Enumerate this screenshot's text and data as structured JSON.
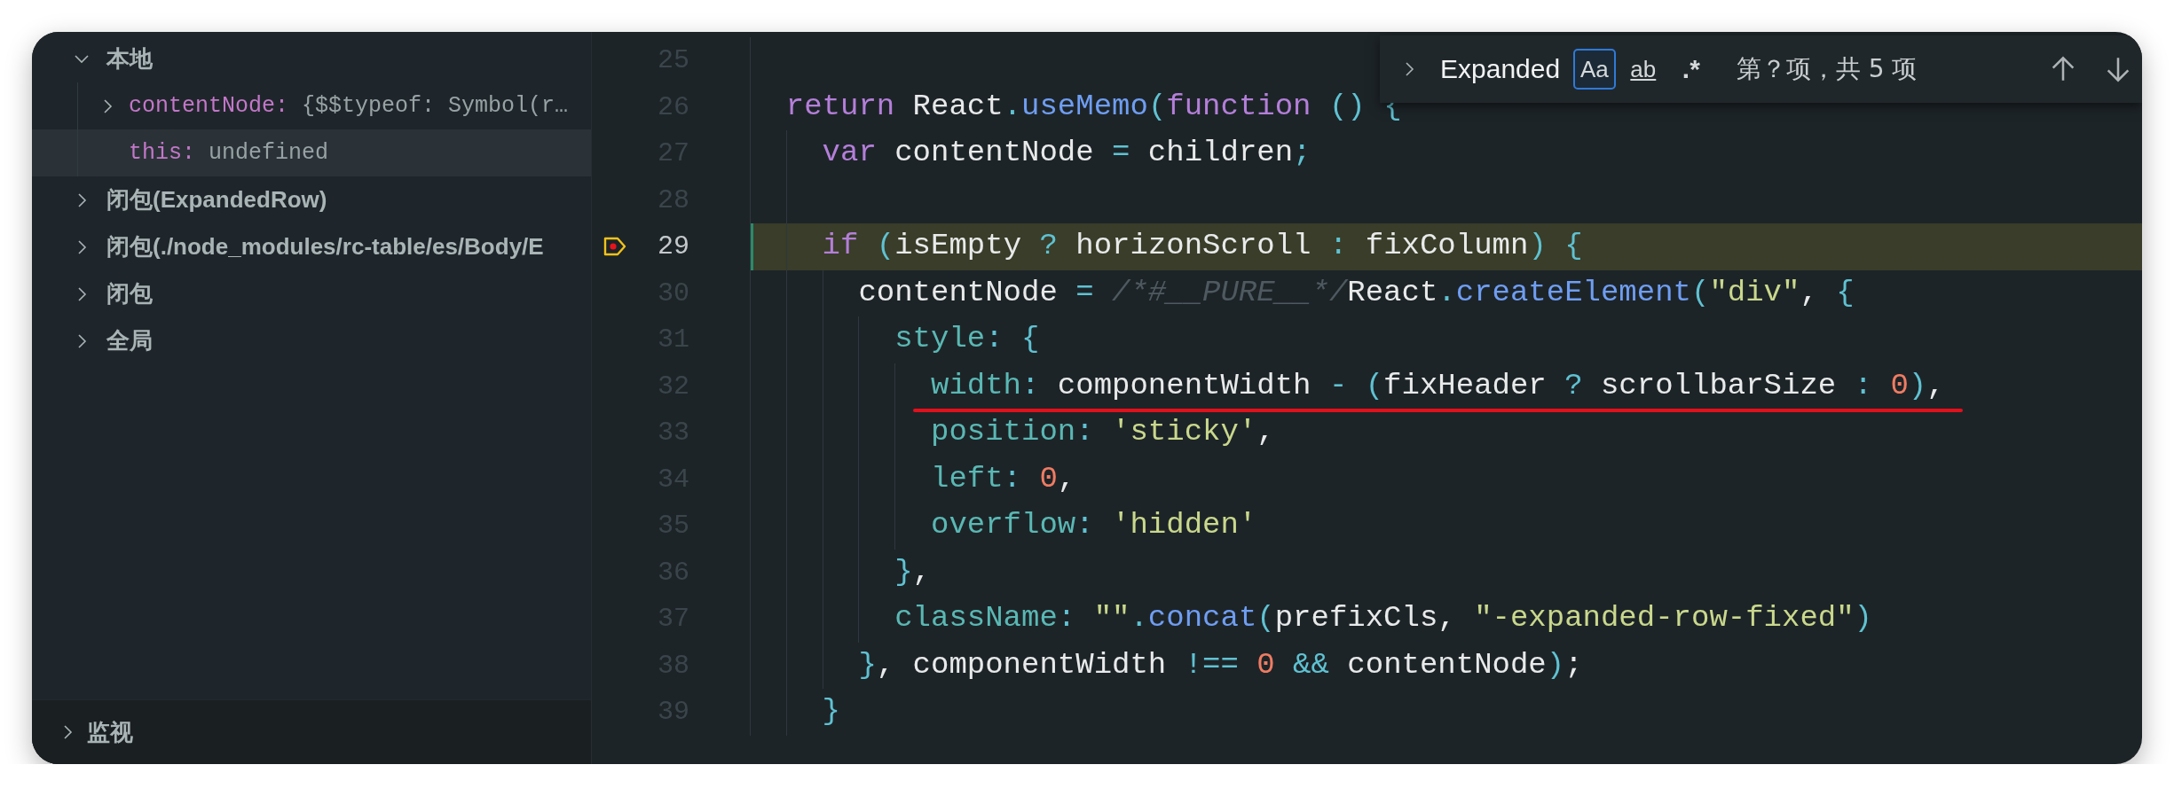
{
  "variables": {
    "scopes": [
      {
        "kind": "scope",
        "label": "本地",
        "expanded": true,
        "selected": false,
        "children": [
          {
            "kind": "object",
            "name": "contentNode:",
            "value": "{$$typeof: Symbol(r…",
            "expanded": false,
            "selected": false
          },
          {
            "kind": "primitive",
            "name": "this:",
            "value": "undefined",
            "selected": true
          }
        ]
      },
      {
        "kind": "scope",
        "label": "闭包(ExpandedRow)",
        "expanded": false,
        "selected": false
      },
      {
        "kind": "scope",
        "label": "闭包(./node_modules/rc-table/es/Body/E",
        "expanded": false,
        "selected": false
      },
      {
        "kind": "scope",
        "label": "闭包",
        "expanded": false,
        "selected": false
      },
      {
        "kind": "scope",
        "label": "全局",
        "expanded": false,
        "selected": false
      }
    ]
  },
  "watch": {
    "label": "监视",
    "expanded": false
  },
  "editor": {
    "lines": [
      {
        "number": "25",
        "current": false,
        "underlined": false
      },
      {
        "number": "26",
        "current": false,
        "underlined": false,
        "tokens": [
          {
            "kind": "keyword",
            "t": "  return"
          },
          {
            "kind": "plain",
            "t": " React"
          },
          {
            "kind": "punct",
            "t": "."
          },
          {
            "kind": "function",
            "t": "useMemo"
          },
          {
            "kind": "punct",
            "t": "("
          },
          {
            "kind": "keyword",
            "t": "function"
          },
          {
            "kind": "punct",
            "t": " ()"
          },
          {
            "kind": "punct",
            "t": " {"
          }
        ]
      },
      {
        "number": "27",
        "current": false,
        "underlined": false,
        "tokens": [
          {
            "kind": "keyword",
            "t": "    var"
          },
          {
            "kind": "plain",
            "t": " contentNode"
          },
          {
            "kind": "punct",
            "t": " ="
          },
          {
            "kind": "plain",
            "t": " children"
          },
          {
            "kind": "punct",
            "t": ";"
          }
        ]
      },
      {
        "number": "28",
        "current": false,
        "underlined": false
      },
      {
        "number": "29",
        "current": true,
        "underlined": false,
        "tokens": [
          {
            "kind": "keyword",
            "t": "    if"
          },
          {
            "kind": "punct",
            "t": " ("
          },
          {
            "kind": "plain",
            "t": "isEmpty"
          },
          {
            "kind": "punct",
            "t": " ?"
          },
          {
            "kind": "plain",
            "t": " horizonScroll"
          },
          {
            "kind": "punct",
            "t": " :"
          },
          {
            "kind": "plain",
            "t": " fixColumn"
          },
          {
            "kind": "punct",
            "t": ")"
          },
          {
            "kind": "punct",
            "t": " {"
          }
        ]
      },
      {
        "number": "30",
        "current": false,
        "underlined": false,
        "tokens": [
          {
            "kind": "plain",
            "t": "      contentNode"
          },
          {
            "kind": "punct",
            "t": " ="
          },
          {
            "kind": "comment",
            "t": " /*#__PURE__*/"
          },
          {
            "kind": "plain",
            "t": "React"
          },
          {
            "kind": "punct",
            "t": "."
          },
          {
            "kind": "function",
            "t": "createElement"
          },
          {
            "kind": "punct",
            "t": "("
          },
          {
            "kind": "string",
            "t": "\"div\""
          },
          {
            "kind": "plain",
            "t": ","
          },
          {
            "kind": "punct",
            "t": " {"
          }
        ]
      },
      {
        "number": "31",
        "current": false,
        "underlined": false,
        "tokens": [
          {
            "kind": "property",
            "t": "        style"
          },
          {
            "kind": "punct",
            "t": ":"
          },
          {
            "kind": "punct",
            "t": " {"
          }
        ]
      },
      {
        "number": "32",
        "current": false,
        "underlined": true,
        "tokens": [
          {
            "kind": "property",
            "t": "          width"
          },
          {
            "kind": "punct",
            "t": ":"
          },
          {
            "kind": "plain",
            "t": " componentWidth"
          },
          {
            "kind": "punct",
            "t": " -"
          },
          {
            "kind": "punct",
            "t": " ("
          },
          {
            "kind": "plain",
            "t": "fixHeader"
          },
          {
            "kind": "punct",
            "t": " ?"
          },
          {
            "kind": "plain",
            "t": " scrollbarSize"
          },
          {
            "kind": "punct",
            "t": " :"
          },
          {
            "kind": "number",
            "t": " 0"
          },
          {
            "kind": "punct",
            "t": ")"
          },
          {
            "kind": "plain",
            "t": ","
          }
        ]
      },
      {
        "number": "33",
        "current": false,
        "underlined": false,
        "tokens": [
          {
            "kind": "property",
            "t": "          position"
          },
          {
            "kind": "punct",
            "t": ":"
          },
          {
            "kind": "string",
            "t": " 'sticky'"
          },
          {
            "kind": "plain",
            "t": ","
          }
        ]
      },
      {
        "number": "34",
        "current": false,
        "underlined": false,
        "tokens": [
          {
            "kind": "property",
            "t": "          left"
          },
          {
            "kind": "punct",
            "t": ":"
          },
          {
            "kind": "number",
            "t": " 0"
          },
          {
            "kind": "plain",
            "t": ","
          }
        ]
      },
      {
        "number": "35",
        "current": false,
        "underlined": false,
        "tokens": [
          {
            "kind": "property",
            "t": "          overflow"
          },
          {
            "kind": "punct",
            "t": ":"
          },
          {
            "kind": "string",
            "t": " 'hidden'"
          }
        ]
      },
      {
        "number": "36",
        "current": false,
        "underlined": false,
        "tokens": [
          {
            "kind": "punct",
            "t": "        }"
          },
          {
            "kind": "plain",
            "t": ","
          }
        ]
      },
      {
        "number": "37",
        "current": false,
        "underlined": false,
        "tokens": [
          {
            "kind": "property",
            "t": "        className"
          },
          {
            "kind": "punct",
            "t": ":"
          },
          {
            "kind": "string",
            "t": " \"\""
          },
          {
            "kind": "punct",
            "t": "."
          },
          {
            "kind": "function",
            "t": "concat"
          },
          {
            "kind": "punct",
            "t": "("
          },
          {
            "kind": "plain",
            "t": "prefixCls"
          },
          {
            "kind": "plain",
            "t": ","
          },
          {
            "kind": "string",
            "t": " \"-expanded-row-fixed\""
          },
          {
            "kind": "punct",
            "t": ")"
          }
        ]
      },
      {
        "number": "38",
        "current": false,
        "underlined": false,
        "tokens": [
          {
            "kind": "punct",
            "t": "      }"
          },
          {
            "kind": "plain",
            "t": ","
          },
          {
            "kind": "plain",
            "t": " componentWidth"
          },
          {
            "kind": "punct",
            "t": " !=="
          },
          {
            "kind": "number",
            "t": " 0"
          },
          {
            "kind": "punct",
            "t": " &&"
          },
          {
            "kind": "plain",
            "t": " contentNode"
          },
          {
            "kind": "punct",
            "t": ")"
          },
          {
            "kind": "plain",
            "t": ";"
          }
        ]
      },
      {
        "number": "39",
        "current": false,
        "underlined": false,
        "tokens": [
          {
            "kind": "punct",
            "t": "    }"
          }
        ]
      }
    ]
  },
  "find_widget": {
    "expanded": false,
    "query": "Expanded",
    "toggles": [
      {
        "label": "Aa",
        "on": true
      },
      {
        "label": "ab",
        "on": false
      },
      {
        "label": ".*",
        "on": false
      }
    ],
    "result": "第？项，共 5 项"
  }
}
